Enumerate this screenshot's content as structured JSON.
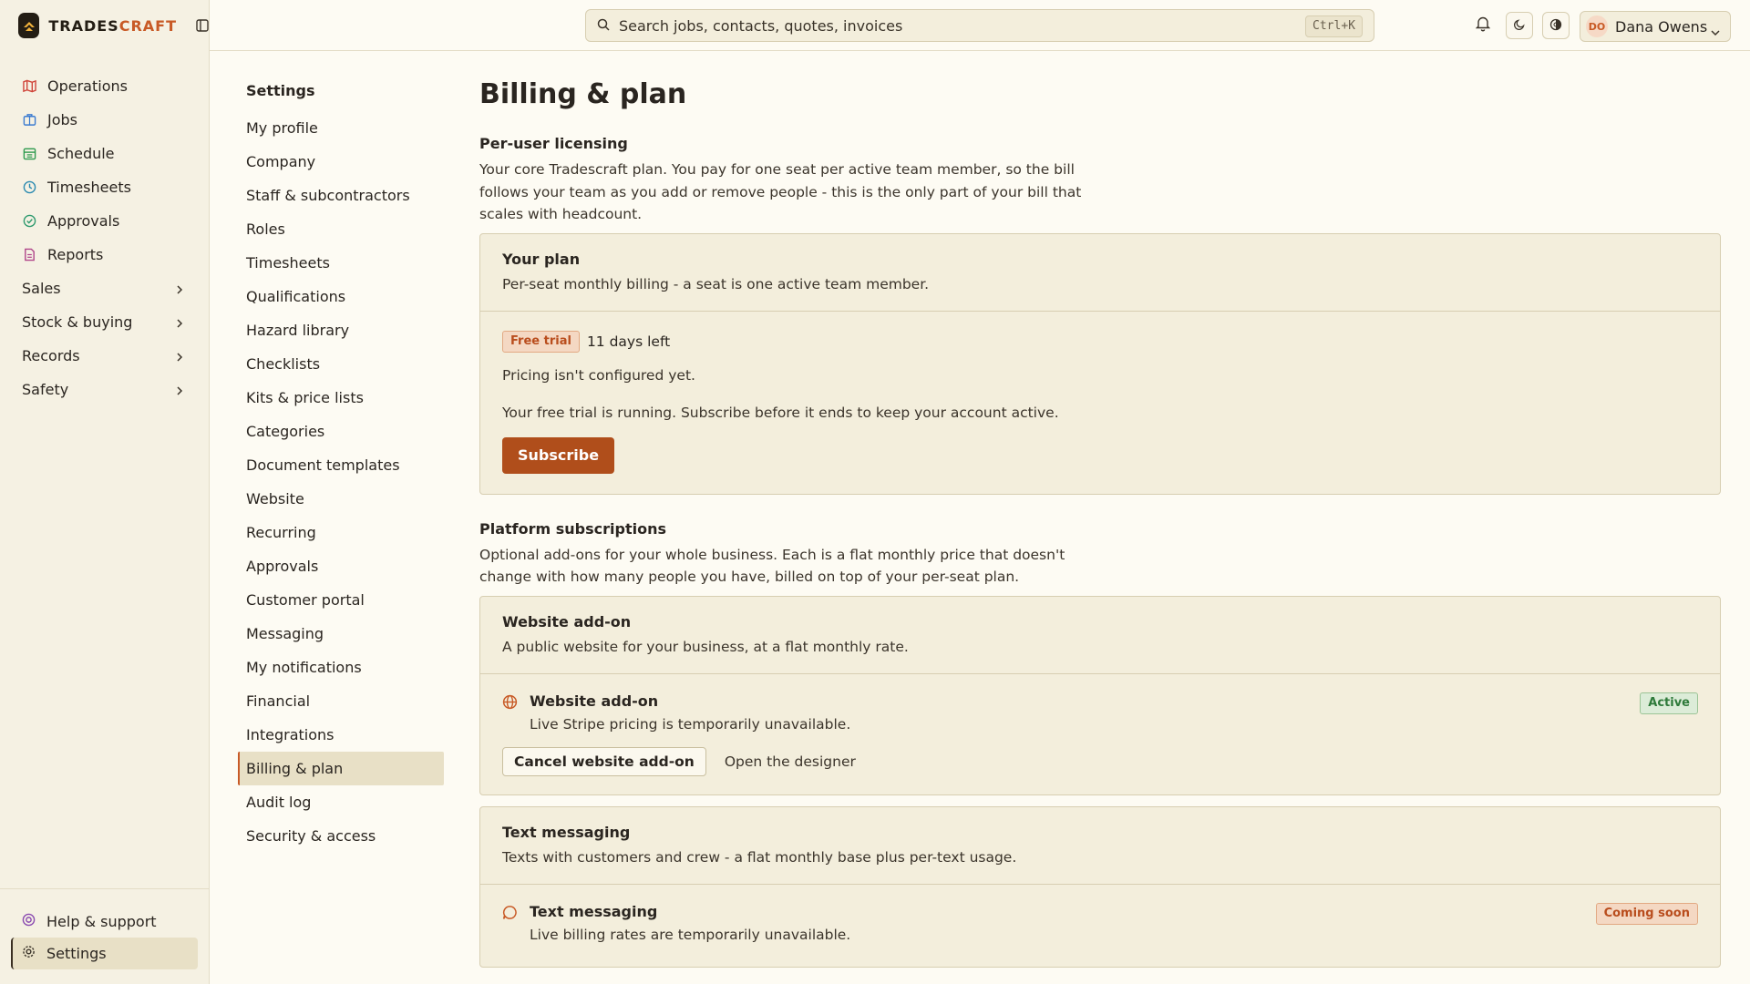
{
  "app": {
    "brand_prefix": "TRADES",
    "brand_accent": "CRAFT",
    "accent_color": "#c85a26"
  },
  "sidebar": {
    "items": [
      {
        "label": "Operations",
        "icon": "map-icon"
      },
      {
        "label": "Jobs",
        "icon": "briefcase-icon"
      },
      {
        "label": "Schedule",
        "icon": "calendar-icon"
      },
      {
        "label": "Timesheets",
        "icon": "clock-icon"
      },
      {
        "label": "Approvals",
        "icon": "check-circle-icon"
      },
      {
        "label": "Reports",
        "icon": "document-icon"
      }
    ],
    "groups": [
      {
        "label": "Sales"
      },
      {
        "label": "Stock & buying"
      },
      {
        "label": "Records"
      },
      {
        "label": "Safety"
      }
    ],
    "help_label": "Help & support",
    "settings_label": "Settings"
  },
  "topbar": {
    "search_placeholder": "Search jobs, contacts, quotes, invoices",
    "search_shortcut": "Ctrl+K",
    "user_initials": "DO",
    "user_name": "Dana Owens"
  },
  "settings_nav": {
    "title": "Settings",
    "items": [
      "My profile",
      "Company",
      "Staff & subcontractors",
      "Roles",
      "Timesheets",
      "Qualifications",
      "Hazard library",
      "Checklists",
      "Kits & price lists",
      "Categories",
      "Document templates",
      "Website",
      "Recurring",
      "Approvals",
      "Customer portal",
      "Messaging",
      "My notifications",
      "Financial",
      "Integrations",
      "Billing & plan",
      "Audit log",
      "Security & access"
    ],
    "active": "Billing & plan"
  },
  "main": {
    "title": "Billing & plan",
    "licensing": {
      "title": "Per-user licensing",
      "desc": "Your core Tradescraft plan. You pay for one seat per active team member, so the bill follows your team as you add or remove people - this is the only part of your bill that scales with headcount.",
      "card": {
        "title": "Your plan",
        "desc": "Per-seat monthly billing - a seat is one active team member.",
        "trial_badge": "Free trial",
        "days_left": "11 days left",
        "pricing_note": "Pricing isn't configured yet.",
        "trial_note": "Your free trial is running. Subscribe before it ends to keep your account active.",
        "subscribe_label": "Subscribe"
      }
    },
    "platform": {
      "title": "Platform subscriptions",
      "desc": "Optional add-ons for your whole business. Each is a flat monthly price that doesn't change with how many people you have, billed on top of your per-seat plan.",
      "website": {
        "title": "Website add-on",
        "desc": "A public website for your business, at a flat monthly rate.",
        "item_title": "Website add-on",
        "item_sub": "Live Stripe pricing is temporarily unavailable.",
        "status": "Active",
        "cancel_label": "Cancel website add-on",
        "designer_label": "Open the designer"
      },
      "texting": {
        "title": "Text messaging",
        "desc": "Texts with customers and crew - a flat monthly base plus per-text usage.",
        "item_title": "Text messaging",
        "item_sub": "Live billing rates are temporarily unavailable.",
        "status": "Coming soon"
      }
    }
  }
}
